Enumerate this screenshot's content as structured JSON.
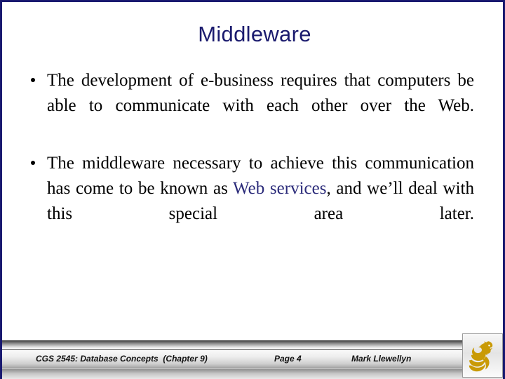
{
  "slide": {
    "border_color": "#191970",
    "background_color": "#ffffff",
    "title": "Middleware",
    "title_color": "#1b1b6e"
  },
  "body": {
    "bullets": [
      {
        "marker": "bullet-dot",
        "text_before": "The development of e-business requires that computers be able to communicate with each other over the Web.",
        "highlight": "",
        "text_after": ""
      },
      {
        "marker": "bullet-dot",
        "text_before": "The middleware necessary to achieve this communication has come to be known as ",
        "highlight": "Web services",
        "highlight_color": "#2b2b7a",
        "text_after": ", and we’ll deal with this special area later."
      }
    ]
  },
  "footer": {
    "course": "CGS 2545: Database Concepts  (Chapter 9)",
    "page": "Page 4",
    "author": "Mark Llewellyn",
    "logo_name": "ucf-pegasus-logo",
    "logo_color": "#c99a06"
  }
}
